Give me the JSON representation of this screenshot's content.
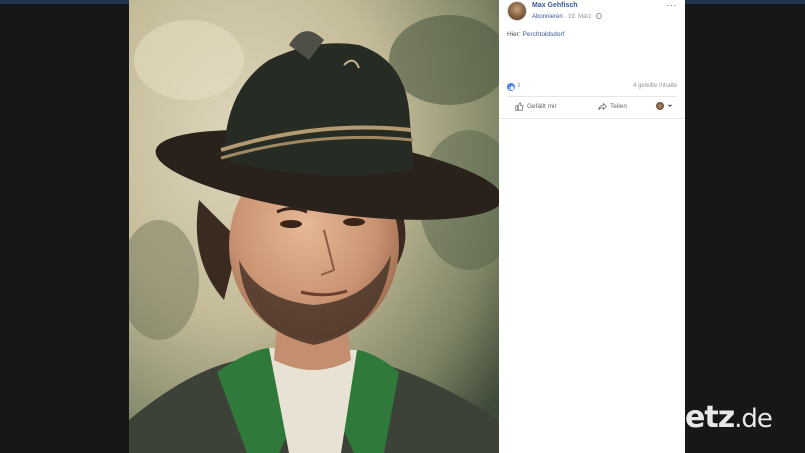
{
  "post": {
    "author": "Max Gehfisch",
    "subscribe": "Abonnieren",
    "separator": "·",
    "date": "19. März",
    "more_icon": "···",
    "checkin_prefix": "Hier:",
    "location": "Perchtoldsdorf",
    "like_count": "3",
    "shares": "4 geteilte Inhalte",
    "actions": {
      "like": "Gefällt mir",
      "share": "Teilen"
    }
  },
  "watermark": {
    "text": "etz",
    "tld": ".de"
  },
  "colors": {
    "link": "#385898",
    "like_badge": "#4a7ff2",
    "panel_bg": "#ffffff",
    "lightbox_bg": "#151719",
    "topbar": "#25344f"
  },
  "icons": [
    "globe-icon",
    "more-icon",
    "like-badge-icon",
    "like-icon",
    "share-icon",
    "reaction-avatar-icon",
    "chevron-down-icon"
  ]
}
